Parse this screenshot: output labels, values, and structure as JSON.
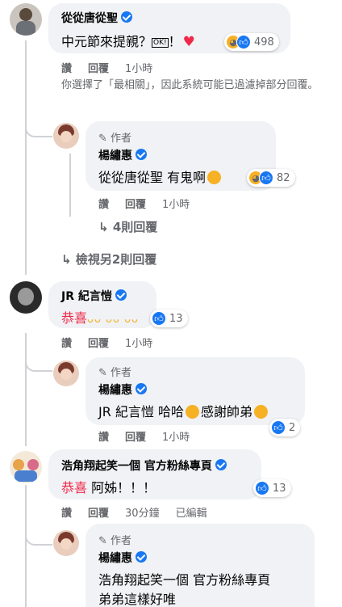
{
  "actions": {
    "like": "讚",
    "reply": "回覆",
    "edited": "已編輯"
  },
  "author_label": "作者",
  "c1": {
    "name": "從從唐從聖",
    "text": "中元節來提親？",
    "text_suffix": "！",
    "ok_label": "OK!",
    "reactions": "498",
    "time": "1小時",
    "filter_notice": "你選擇了「最相關」，因此系統可能已過濾掉部分回覆。"
  },
  "r1": {
    "name": "楊繡惠",
    "mention": "從從唐從聖",
    "text": "有鬼啊",
    "reactions": "82",
    "time": "1小時",
    "more_replies": "4則回覆"
  },
  "view_more": "檢視另2則回覆",
  "c2": {
    "name": "JR 紀言愷",
    "text": "恭喜",
    "reactions": "13",
    "time": "1小時"
  },
  "r2": {
    "name": "楊繡惠",
    "mention": "JR 紀言愷",
    "text_a": "哈哈",
    "text_b": "感謝帥弟",
    "reactions": "2",
    "time": "1小時"
  },
  "c3": {
    "name": "浩角翔起笑一個 官方粉絲專頁",
    "text_tag": "恭喜",
    "text": "阿姊！！！",
    "reactions": "13",
    "time": "30分鐘"
  },
  "r3": {
    "name": "楊繡惠",
    "mention": "浩角翔起笑一個 官方粉絲專頁",
    "text": "弟弟這樣好唯"
  }
}
